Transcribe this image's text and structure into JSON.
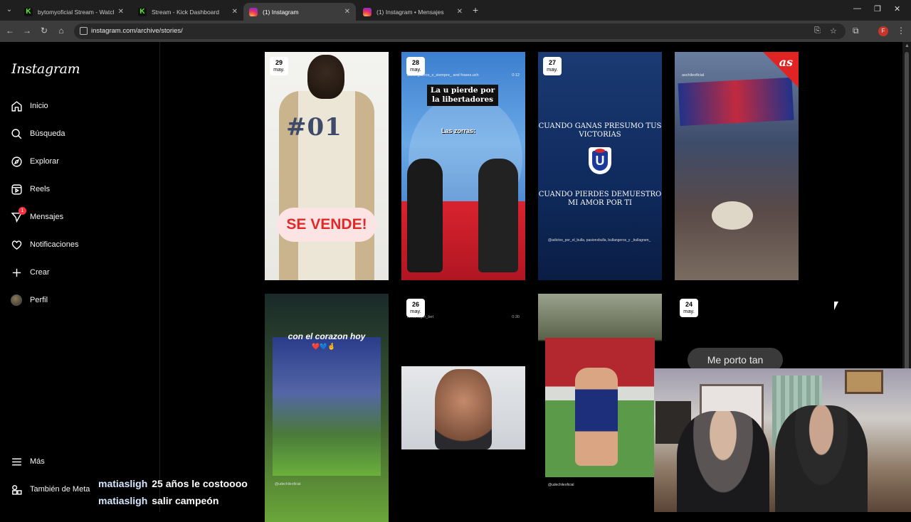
{
  "browser": {
    "tabs": [
      {
        "title": "bytomyoficial Stream - Watch l",
        "favicon": "kick"
      },
      {
        "title": "Stream - Kick Dashboard",
        "favicon": "kick"
      },
      {
        "title": "(1) Instagram",
        "favicon": "instagram",
        "active": true
      },
      {
        "title": "(1) Instagram • Mensajes",
        "favicon": "instagram"
      }
    ],
    "url": "instagram.com/archive/stories/",
    "profile_initial": "F"
  },
  "sidebar": {
    "logo": "Instagram",
    "items": [
      {
        "label": "Inicio",
        "icon": "home-icon"
      },
      {
        "label": "Búsqueda",
        "icon": "search-icon"
      },
      {
        "label": "Explorar",
        "icon": "compass-icon"
      },
      {
        "label": "Reels",
        "icon": "reels-icon"
      },
      {
        "label": "Mensajes",
        "icon": "messages-icon",
        "badge": "1"
      },
      {
        "label": "Notificaciones",
        "icon": "heart-icon"
      },
      {
        "label": "Crear",
        "icon": "plus-icon"
      },
      {
        "label": "Perfil",
        "icon": "avatar"
      }
    ],
    "more": "Más",
    "meta": "También de Meta"
  },
  "stories": [
    {
      "day": "29",
      "month": "may.",
      "overlay_text": "SE VENDE!"
    },
    {
      "day": "28",
      "month": "may.",
      "caption": "bullangueros_x_siempre_ and frases.uch",
      "duration": "0:12",
      "title": "La u pierde por la libertadores",
      "subtitle": "Las zorras:"
    },
    {
      "day": "27",
      "month": "may.",
      "top_text": "CUANDO GANAS PRESUMO TUS VICTORIAS",
      "bottom_text": "CUANDO PIERDES DEMUESTRO MI AMOR POR TI",
      "credits": "@adictos_por_el_bulla, pasionxbulla, bullangeros_y _bullagram_"
    },
    {
      "account": "aschileoficial",
      "brand": "as"
    },
    {
      "text": "con el corazon hoy",
      "emoji": "❤️💙🤞",
      "footer": "@udechileoficial"
    },
    {
      "day": "26",
      "month": "may.",
      "account": "fumanager_bet",
      "duration": "0:30"
    },
    {
      "footer": "@udechileoficial"
    },
    {
      "day": "24",
      "month": "may.",
      "bubble": "Me porto tan"
    }
  ],
  "chat": [
    {
      "user": "matiasligh",
      "message": "25 años le costoooo"
    },
    {
      "user": "matiasligh",
      "message": "salir campeón"
    }
  ]
}
